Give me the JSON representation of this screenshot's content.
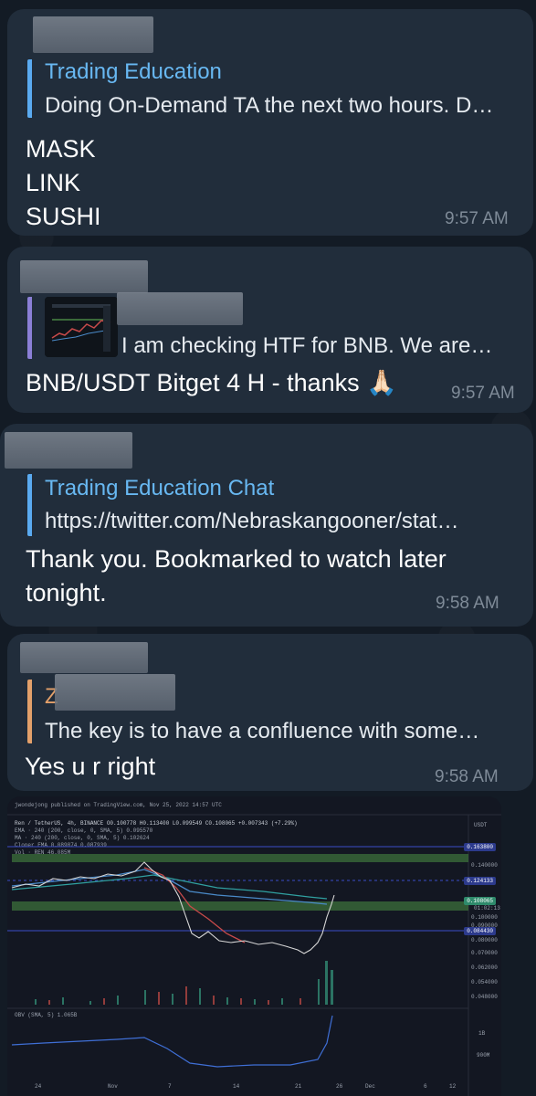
{
  "messages": [
    {
      "reply": {
        "title": "Trading Education",
        "text": "Doing On-Demand TA the next two hours. D…"
      },
      "lines": [
        "MASK",
        "LINK",
        "SUSHI"
      ],
      "time": "9:57 AM"
    },
    {
      "reply": {
        "title": "",
        "text": "I am checking HTF for BNB. We are…"
      },
      "lines": [
        "BNB/USDT Bitget 4 H - thanks 🙏🏻"
      ],
      "time": "9:57 AM"
    },
    {
      "reply": {
        "title": "Trading Education Chat",
        "text": "https://twitter.com/Nebraskangooner/stat…"
      },
      "lines": [
        "Thank you. Bookmarked to watch later",
        "tonight."
      ],
      "time": "9:58 AM"
    },
    {
      "reply": {
        "title": "Z",
        "text": "The key is to have a confluence with some…"
      },
      "lines": [
        "Yes u r right"
      ],
      "time": "9:58 AM"
    }
  ],
  "colors": {
    "background": "#131b25",
    "bubble": "#212d3b",
    "reply_blue": "#5aaaf0",
    "reply_purple": "#8b7fd6",
    "reply_orange": "#e3a06a",
    "time": "#7f8b98"
  },
  "chart_image": {
    "header": "jwondejong published on TradingView.com, Nov 25, 2022 14:57 UTC",
    "symbol_line": "Ren / TetherUS, 4h, BINANCE  O0.100778  H0.113400  L0.099549  C0.108065  +0.007343 (+7.29%)",
    "indicators": [
      "EMA · 240 (200, close, 0, SMA, 5)  0.095570",
      "MA · 240 (200, close, 0, SMA, 5)  0.102624",
      "Cloner EMA  0.089874  0.087939",
      "Vol · REN  46.085M"
    ],
    "currency": "USDT",
    "price_ticks": [
      "0.163800",
      "0.140000",
      "0.124133",
      "0.108065",
      "01:02:13",
      "0.100000",
      "0.090000",
      "0.084430",
      "0.080000",
      "0.070000",
      "0.062000",
      "0.054000",
      "0.048000"
    ],
    "obv_label": "OBV (SMA, 5)  1.065B",
    "obv_ticks": [
      "1B",
      "900M"
    ],
    "x_ticks": [
      "24",
      "Nov",
      "7",
      "14",
      "21",
      "26",
      "Dec",
      "6",
      "12"
    ]
  }
}
